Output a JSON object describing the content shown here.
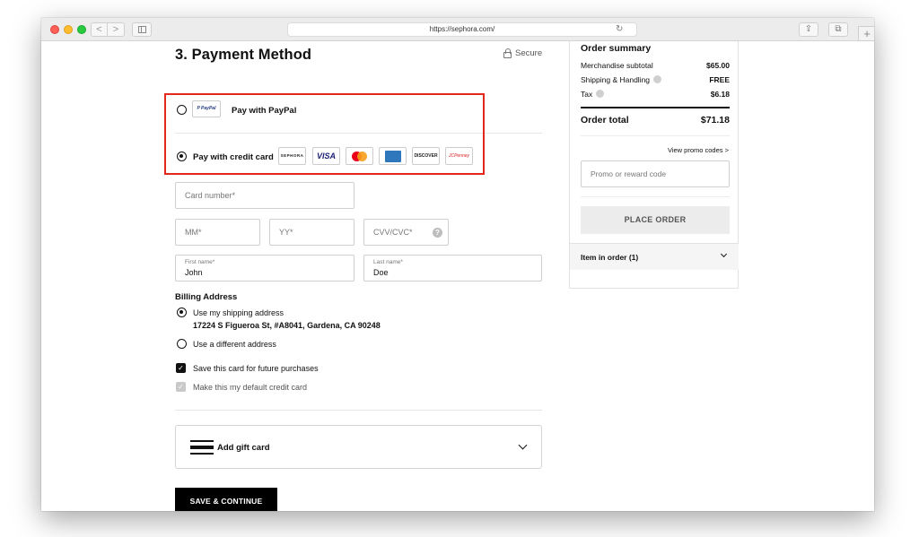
{
  "browser": {
    "url": "https://sephora.com/",
    "back_glyph": "<",
    "forward_glyph": ">",
    "reload_glyph": "↻",
    "share_glyph": "⇪",
    "tabs_glyph": "⧉",
    "newtab_glyph": "+"
  },
  "payment": {
    "title": "3. Payment Method",
    "secure_label": "Secure",
    "paypal_logo_text": "P PayPal",
    "paypal_label": "Pay with PayPal",
    "credit_label": "Pay with credit card",
    "cards": {
      "sephora": "SEPHORA",
      "visa": "VISA",
      "discover": "DISCOVER",
      "jcpenney": "JCPenney"
    },
    "highlight_color": "#e3281b"
  },
  "form": {
    "card_number_placeholder": "Card number*",
    "mm_placeholder": "MM*",
    "yy_placeholder": "YY*",
    "cvv_placeholder": "CVV/CVC*",
    "help_glyph": "?",
    "first_name_label": "First name*",
    "first_name_value": "John",
    "last_name_label": "Last name*",
    "last_name_value": "Doe"
  },
  "billing": {
    "heading": "Billing Address",
    "use_shipping": "Use my shipping address",
    "shipping_address": "17224 S Figueroa St, #A8041, Gardena, CA 90248",
    "use_different": "Use a different address",
    "save_card": "Save this card for future purchases",
    "default_card": "Make this my default credit card",
    "check_glyph": "✓"
  },
  "gift_card": {
    "label": "Add gift card"
  },
  "save_continue": "SAVE & CONTINUE",
  "summary": {
    "title": "Order summary",
    "merch_label": "Merchandise subtotal",
    "merch_value": "$65.00",
    "shipping_label": "Shipping & Handling",
    "shipping_value": "FREE",
    "tax_label": "Tax",
    "tax_value": "$6.18",
    "total_label": "Order total",
    "total_value": "$71.18",
    "promo_link": "View promo codes >",
    "promo_placeholder": "Promo or reward code",
    "place_order": "PLACE ORDER",
    "items_label": "Item in order (1)"
  }
}
